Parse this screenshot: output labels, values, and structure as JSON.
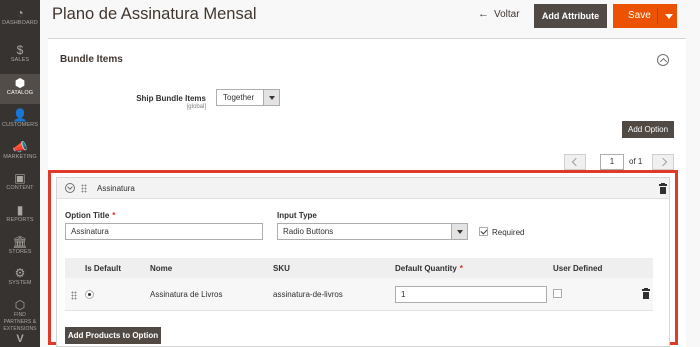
{
  "sidebar": {
    "items": [
      {
        "label": "DASHBOARD",
        "icon": "dashboard-icon",
        "glyph": "◔"
      },
      {
        "label": "SALES",
        "icon": "dollar-icon",
        "glyph": "$"
      },
      {
        "label": "CATALOG",
        "icon": "box-icon",
        "glyph": "⬢"
      },
      {
        "label": "CUSTOMERS",
        "icon": "person-icon",
        "glyph": "👤"
      },
      {
        "label": "MARKETING",
        "icon": "megaphone-icon",
        "glyph": "📣"
      },
      {
        "label": "CONTENT",
        "icon": "layout-icon",
        "glyph": "▣"
      },
      {
        "label": "REPORTS",
        "icon": "bar-chart-icon",
        "glyph": "▮"
      },
      {
        "label": "STORES",
        "icon": "store-icon",
        "glyph": "🏛"
      },
      {
        "label": "SYSTEM",
        "icon": "gear-icon",
        "glyph": "⚙"
      },
      {
        "label": "FIND PARTNERS & EXTENSIONS",
        "icon": "puzzle-icon",
        "glyph": "⬡"
      }
    ],
    "active": "CATALOG",
    "bottom_glyph": "V"
  },
  "header": {
    "title": "Plano de Assinatura Mensal",
    "back_label": "Voltar",
    "back_arrow": "←",
    "add_attribute_label": "Add Attribute",
    "save_label": "Save"
  },
  "bundle": {
    "section_title": "Bundle Items",
    "ship_label": "Ship Bundle Items",
    "ship_scope": "[global]",
    "ship_value": "Together",
    "add_option_label": "Add Option",
    "pager": {
      "page": "1",
      "of_label": "of 1"
    }
  },
  "option": {
    "title": "Assinatura",
    "option_title_label": "Option Title",
    "option_title_value": "Assinatura",
    "input_type_label": "Input Type",
    "input_type_value": "Radio Buttons",
    "required_label": "Required",
    "required_checked": true,
    "grid": {
      "headers": [
        "Is Default",
        "Nome",
        "SKU",
        "Default Quantity",
        "User Defined"
      ],
      "rows": [
        {
          "is_default": true,
          "name": "Assinatura de Livros",
          "sku": "assinatura-de-livros",
          "default_qty": "1",
          "user_defined": false
        }
      ]
    },
    "add_products_label": "Add Products to Option"
  },
  "colors": {
    "sidebar_bg": "#373330",
    "save_orange": "#eb5202",
    "dark_button": "#514943",
    "highlight_red": "#e03a2a"
  }
}
